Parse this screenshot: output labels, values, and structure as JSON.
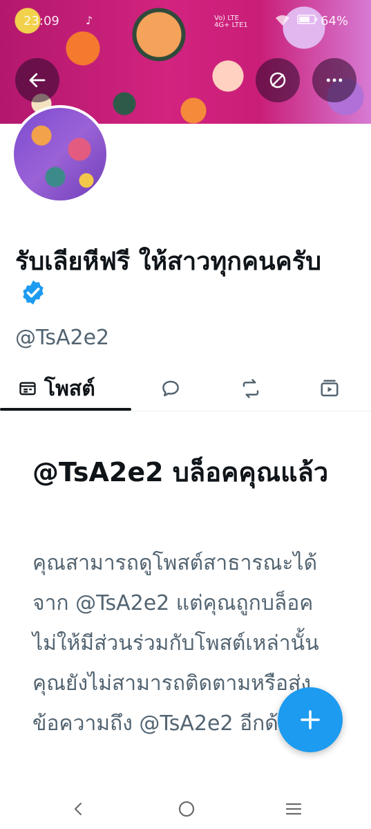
{
  "status_bar": {
    "time": "23:09",
    "app_icon": "tiktok-icon",
    "network_label": "Vo) LTE\n4G+ LTE1",
    "battery_percent": "64%"
  },
  "header": {
    "back_icon": "arrow-left-icon",
    "unblock_icon": "circle-slash-icon",
    "more_icon": "more-horizontal-icon"
  },
  "profile": {
    "display_name": "รับเลียหีฟรี ให้สาวทุกคนครับ",
    "handle": "@TsA2e2",
    "verified": true
  },
  "tabs": [
    {
      "label": "โพสต์",
      "icon": "posts-icon",
      "selected": true
    },
    {
      "label": "",
      "icon": "reply-bubble-icon",
      "selected": false
    },
    {
      "label": "",
      "icon": "repost-icon",
      "selected": false
    },
    {
      "label": "",
      "icon": "media-play-icon",
      "selected": false
    }
  ],
  "blocked": {
    "title": "@TsA2e2 บล็อคคุณแล้ว",
    "description": "คุณสามารถดูโพสต์สาธารณะได้จาก @TsA2e2 แต่คุณถูกบล็อคไม่ให้มีส่วนร่วมกับโพสต์เหล่านั้น คุณยังไม่สามารถติดตามหรือส่งข้อความถึง @TsA2e2 อีกด้วย"
  },
  "fab": {
    "icon": "plus-icon"
  },
  "colors": {
    "accent": "#1d9bf0",
    "text_primary": "#0f1419",
    "text_secondary": "#536471"
  }
}
